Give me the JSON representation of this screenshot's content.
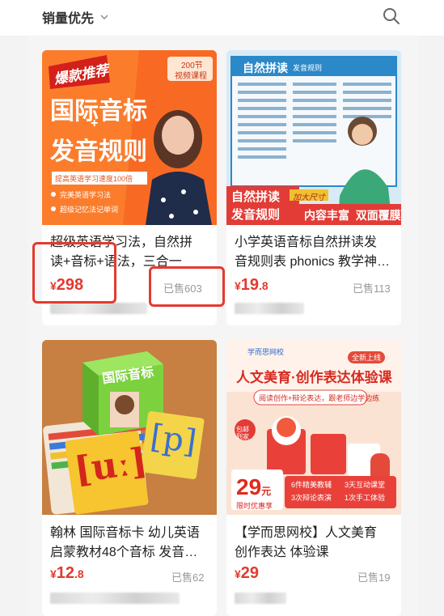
{
  "header": {
    "sort_label": "销量优先",
    "icons": [
      "chevron-down-icon",
      "search-icon"
    ]
  },
  "products": [
    {
      "title_line1": "超级英语学习法，自然拼",
      "title_line2": "读+音标+语法，三合一",
      "price_symbol": "¥",
      "price_int": "298",
      "price_dec": "",
      "sold": "已售603",
      "thumb": {
        "badge": "爆款推荐",
        "corner_top": "200节",
        "corner_bottom": "视频课程",
        "headline1": "国际音标",
        "plus": "+",
        "headline2": "发音规则",
        "tagline": "提高英语学习速度100倍",
        "bullet1": "完美英语学习法",
        "bullet2": "超级记忆法记单词"
      }
    },
    {
      "title_line1": "小学英语音标自然拼读发",
      "title_line2": "音规则表 phonics 教学神…",
      "price_symbol": "¥",
      "price_int": "19",
      "price_dec": ".8",
      "sold": "已售113",
      "thumb": {
        "poster_title": "自然拼读",
        "poster_sub": "发音规则",
        "tag_big": "加大尺寸",
        "label_left1": "自然拼读",
        "label_left2": "发音规则",
        "label_right": "内容丰富  双面覆膜"
      }
    },
    {
      "title_line1": "翰林 国际音标卡 幼儿英语",
      "title_line2": "启蒙教材48个音标 发音…",
      "price_symbol": "¥",
      "price_int": "12",
      "price_dec": ".8",
      "sold": "已售62",
      "thumb": {
        "box_label": "国际音标",
        "card1": "[uː]",
        "card2": "[p]"
      }
    },
    {
      "title_line1": "【学而思网校】人文美育",
      "title_line2": "创作表达 体验课",
      "price_symbol": "¥",
      "price_int": "29",
      "price_dec": "",
      "sold": "已售19",
      "thumb": {
        "brand": "学而思网校",
        "new_tag": "全新上线",
        "headline": "人文美育·创作表达体验课",
        "sub": "阅读创作+辩论表达，跟老师边学边练",
        "promo_price": "29",
        "promo_unit": "元",
        "promo_label": "限时优惠享",
        "feat1": "6件精美教辅",
        "feat2": "3天互动课堂",
        "feat3": "3次辩论表演",
        "feat4": "1次手工体验",
        "gift": "包邮到家"
      }
    }
  ],
  "colors": {
    "price": "#e23a2e",
    "highlight": "#e53a2f"
  }
}
